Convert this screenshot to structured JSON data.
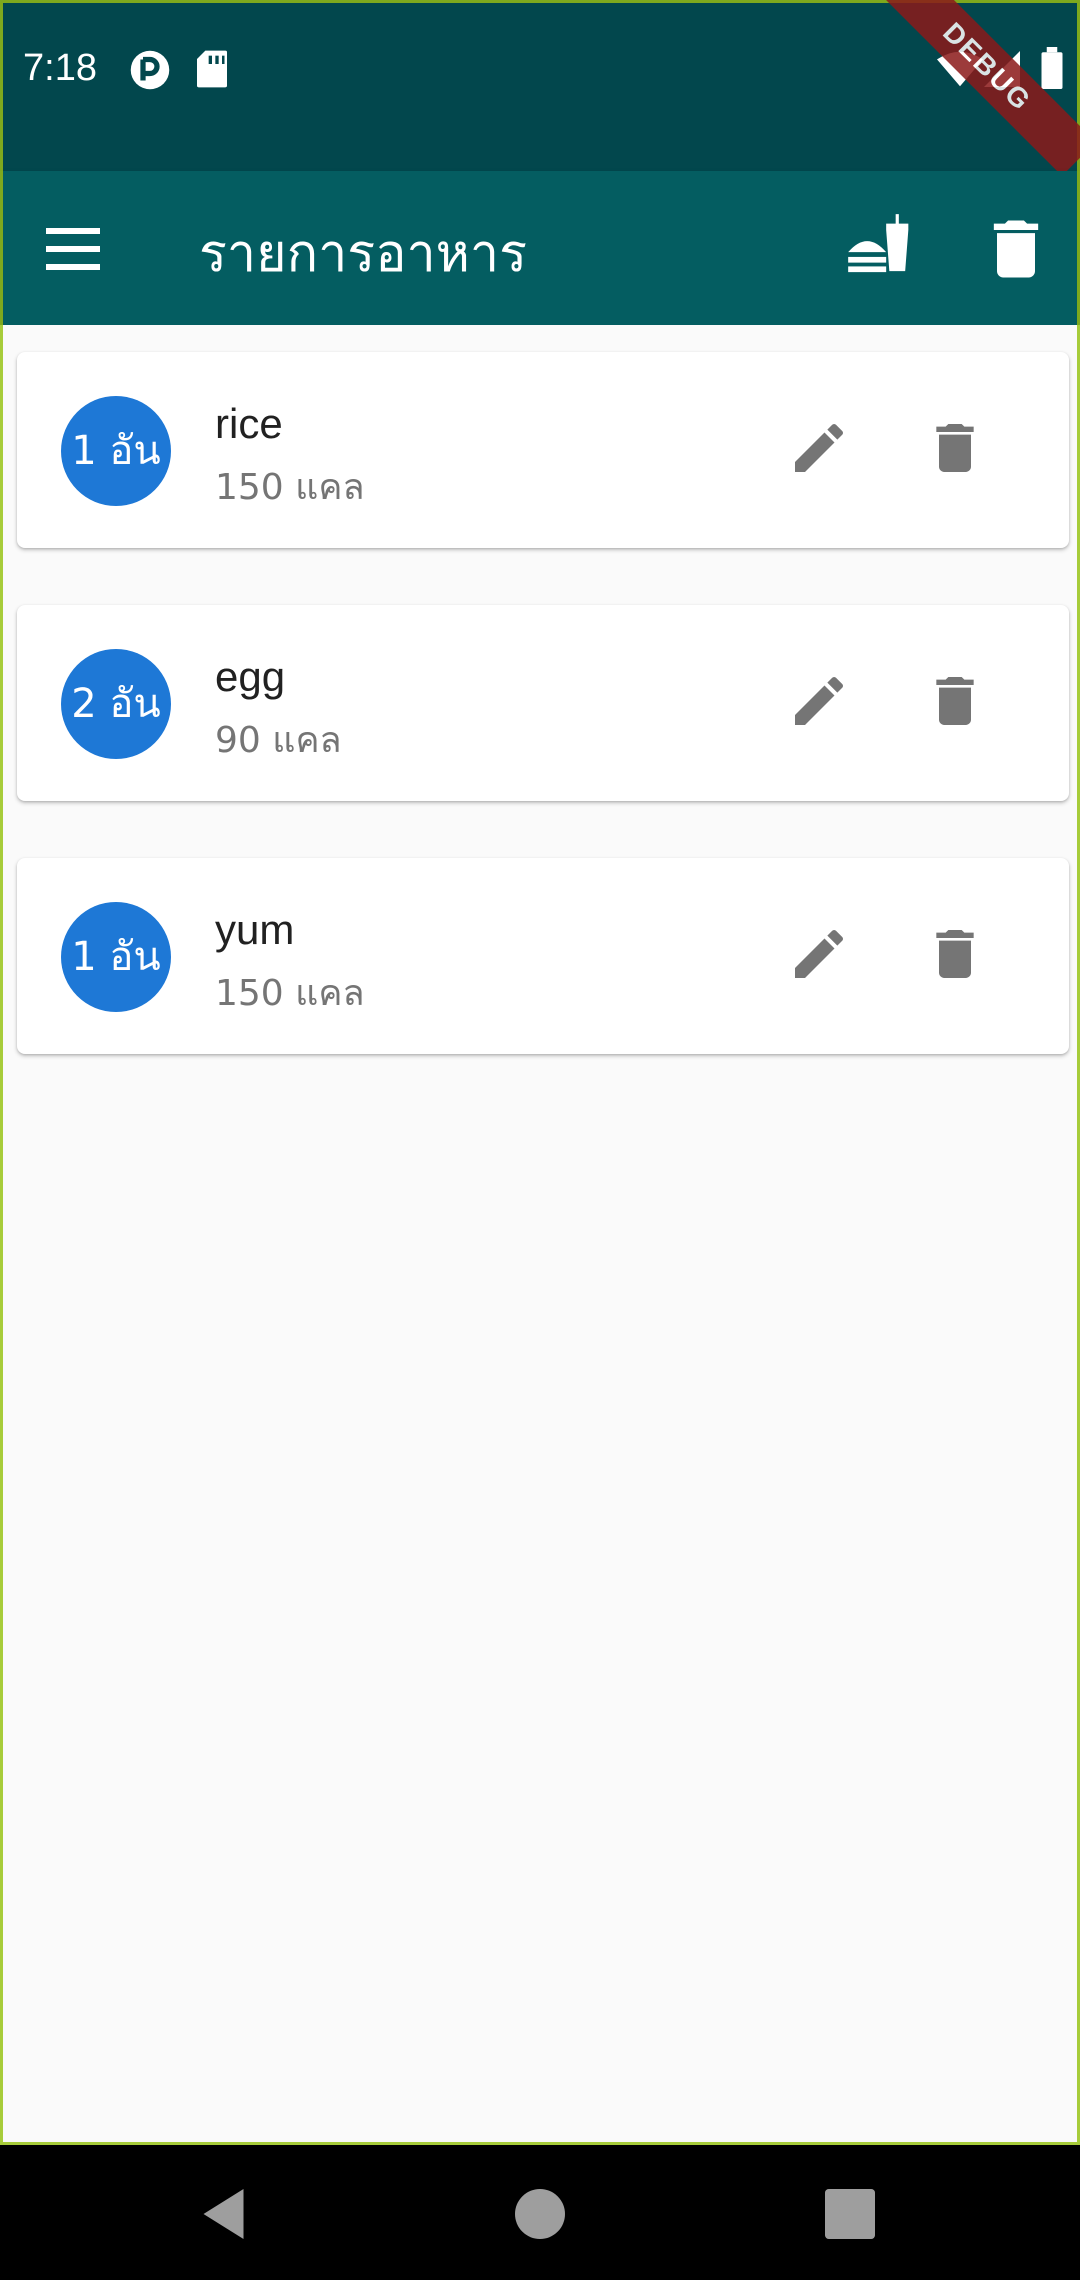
{
  "status_bar": {
    "time": "7:18",
    "debug_label": "DEBUG"
  },
  "app_bar": {
    "title": "รายการอาหาร",
    "menu_icon": "hamburger-menu-icon",
    "actions": [
      "fastfood-icon",
      "delete-icon"
    ]
  },
  "foods": [
    {
      "qty": "1 อัน",
      "name": "rice",
      "calories": "150 แคล"
    },
    {
      "qty": "2 อัน",
      "name": "egg",
      "calories": "90 แคล"
    },
    {
      "qty": "1 อัน",
      "name": "yum",
      "calories": "150 แคล"
    }
  ],
  "colors": {
    "status_bar": "#02474d",
    "app_bar": "#045d61",
    "accent": "#1e78d6",
    "background": "#fafafa",
    "icon_grey": "#757575"
  },
  "nav_bar": [
    "back-icon",
    "home-icon",
    "recents-icon"
  ]
}
